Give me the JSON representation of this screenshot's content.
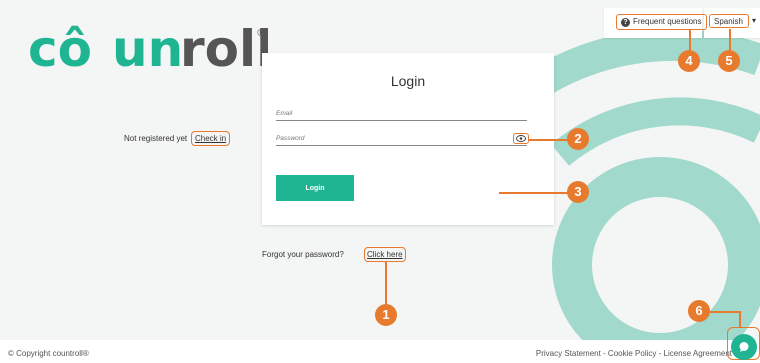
{
  "brand": {
    "logo_text": "countroll",
    "trademark": "®",
    "accent_color": "#1fb592",
    "annotation_color": "#e87a2e"
  },
  "header": {
    "faq_label": "Frequent questions",
    "faq_icon": "question-circle-icon",
    "language_value": "Spanish"
  },
  "login": {
    "title": "Login",
    "email_placeholder": "Email",
    "password_placeholder": "Password",
    "show_password_icon": "eye-icon",
    "login_button": "Login",
    "not_registered_text": "Not registered yet",
    "check_in_link": "Check in"
  },
  "forgot": {
    "text": "Forgot your password?",
    "link": "Click here"
  },
  "annotations": [
    "1",
    "2",
    "3",
    "4",
    "5",
    "6"
  ],
  "footer": {
    "copyright": "© Copyright countroll®",
    "legal": "Privacy Statement - Cookie Policy - License Agreement"
  },
  "chat": {
    "icon": "chat-bubble-icon"
  }
}
